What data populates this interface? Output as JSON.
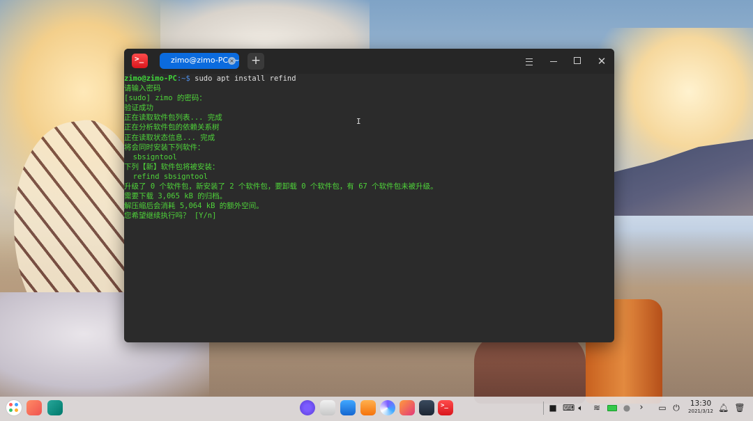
{
  "terminal": {
    "tab_title": "zimo@zimo-PC: ~",
    "new_tab_label": "+",
    "app_icon_text": ">_",
    "prompt": {
      "user_host": "zimo@zimo-PC",
      "path": ":~$ ",
      "command": "sudo apt install refind"
    },
    "output_lines": [
      "请输入密码",
      "[sudo] zimo 的密码：",
      "验证成功",
      "正在读取软件包列表... 完成",
      "正在分析软件包的依赖关系树",
      "正在读取状态信息... 完成",
      "将会同时安装下列软件：",
      "  sbsigntool",
      "下列【新】软件包将被安装：",
      "  refind sbsigntool",
      "升级了 0 个软件包，新安装了 2 个软件包，要卸载 0 个软件包，有 67 个软件包未被升级。",
      "需要下载 3,065 kB 的归档。",
      "解压缩后会消耗 5,064 kB 的额外空间。",
      "您希望继续执行吗？ [Y/n]"
    ]
  },
  "window_controls": {
    "menu": "menu-icon",
    "minimize": "minimize-icon",
    "maximize": "maximize-icon",
    "close": "✕"
  },
  "dock": {
    "apps": [
      "launcher",
      "multitask-view",
      "show-desktop",
      "control-center",
      "camera",
      "app-store",
      "archive-manager",
      "browser",
      "image-viewer",
      "print-manager",
      "terminal"
    ],
    "terminal_icon_text": ">_"
  },
  "tray": {
    "time": "13:30",
    "date": "2021/3/12"
  },
  "colors": {
    "terminal_bg": "#2b2b2b",
    "terminal_text": "#4fd33a",
    "prompt_user": "#3fd63a",
    "prompt_path": "#4d8ee8",
    "tab_active": "#0b6bde",
    "app_icon_red": "#e21d24"
  }
}
